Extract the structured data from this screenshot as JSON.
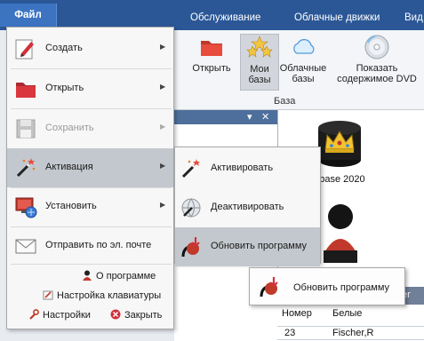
{
  "menubar": {
    "file_tab": "Файл",
    "tabs": [
      "Обслуживание",
      "Облачные движки",
      "Вид"
    ]
  },
  "ribbon": {
    "buttons": [
      {
        "label": "Открыть",
        "icon": "folder-open-icon"
      },
      {
        "label": "Мои\nбазы",
        "icon": "my-databases-stars-icon"
      },
      {
        "label": "Облачные\nбазы",
        "icon": "cloud-icon"
      },
      {
        "label": "Показать\nсодержимое DVD",
        "icon": "dvd-icon"
      }
    ],
    "group_label": "База"
  },
  "panel": {
    "pin_glyph": "▾",
    "close_glyph": "✕"
  },
  "content": {
    "database_label": "Database 2020",
    "table": {
      "header_fragment": "er",
      "columns": [
        "Номер",
        "Белые"
      ],
      "rows": [
        [
          "23",
          "Fischer,R"
        ]
      ]
    }
  },
  "file_menu": {
    "items": [
      {
        "label": "Создать",
        "icon": "pencil-new-icon",
        "has_submenu": true,
        "disabled": false
      },
      {
        "label": "Открыть",
        "icon": "folder-open-icon",
        "has_submenu": true,
        "disabled": false
      },
      {
        "label": "Сохранить",
        "icon": "floppy-disk-icon",
        "has_submenu": true,
        "disabled": true
      },
      {
        "label": "Активация",
        "icon": "magic-wand-icon",
        "has_submenu": true,
        "disabled": false
      },
      {
        "label": "Установить",
        "icon": "install-monitor-icon",
        "has_submenu": true,
        "disabled": false
      },
      {
        "label": "Отправить по эл. почте",
        "icon": "email-envelope-icon",
        "has_submenu": false,
        "disabled": false
      }
    ],
    "footer": {
      "about": "О программе",
      "keyboard": "Настройка клавиатуры",
      "settings": "Настройки",
      "close": "Закрыть"
    }
  },
  "activation_submenu": {
    "items": [
      {
        "label": "Активировать",
        "icon": "magic-wand-icon"
      },
      {
        "label": "Деактивировать",
        "icon": "deactivate-globe-icon"
      },
      {
        "label": "Обновить программу",
        "icon": "update-program-icon"
      }
    ]
  },
  "tooltip": {
    "label": "Обновить программу",
    "icon": "update-program-icon"
  },
  "colors": {
    "menubar_bg": "#2b5797",
    "file_tab_bg": "#3c74c2",
    "hover_bg": "#c3c8ce",
    "panel_header": "#4e6f9b",
    "disabled_text": "#9a9a9a"
  }
}
